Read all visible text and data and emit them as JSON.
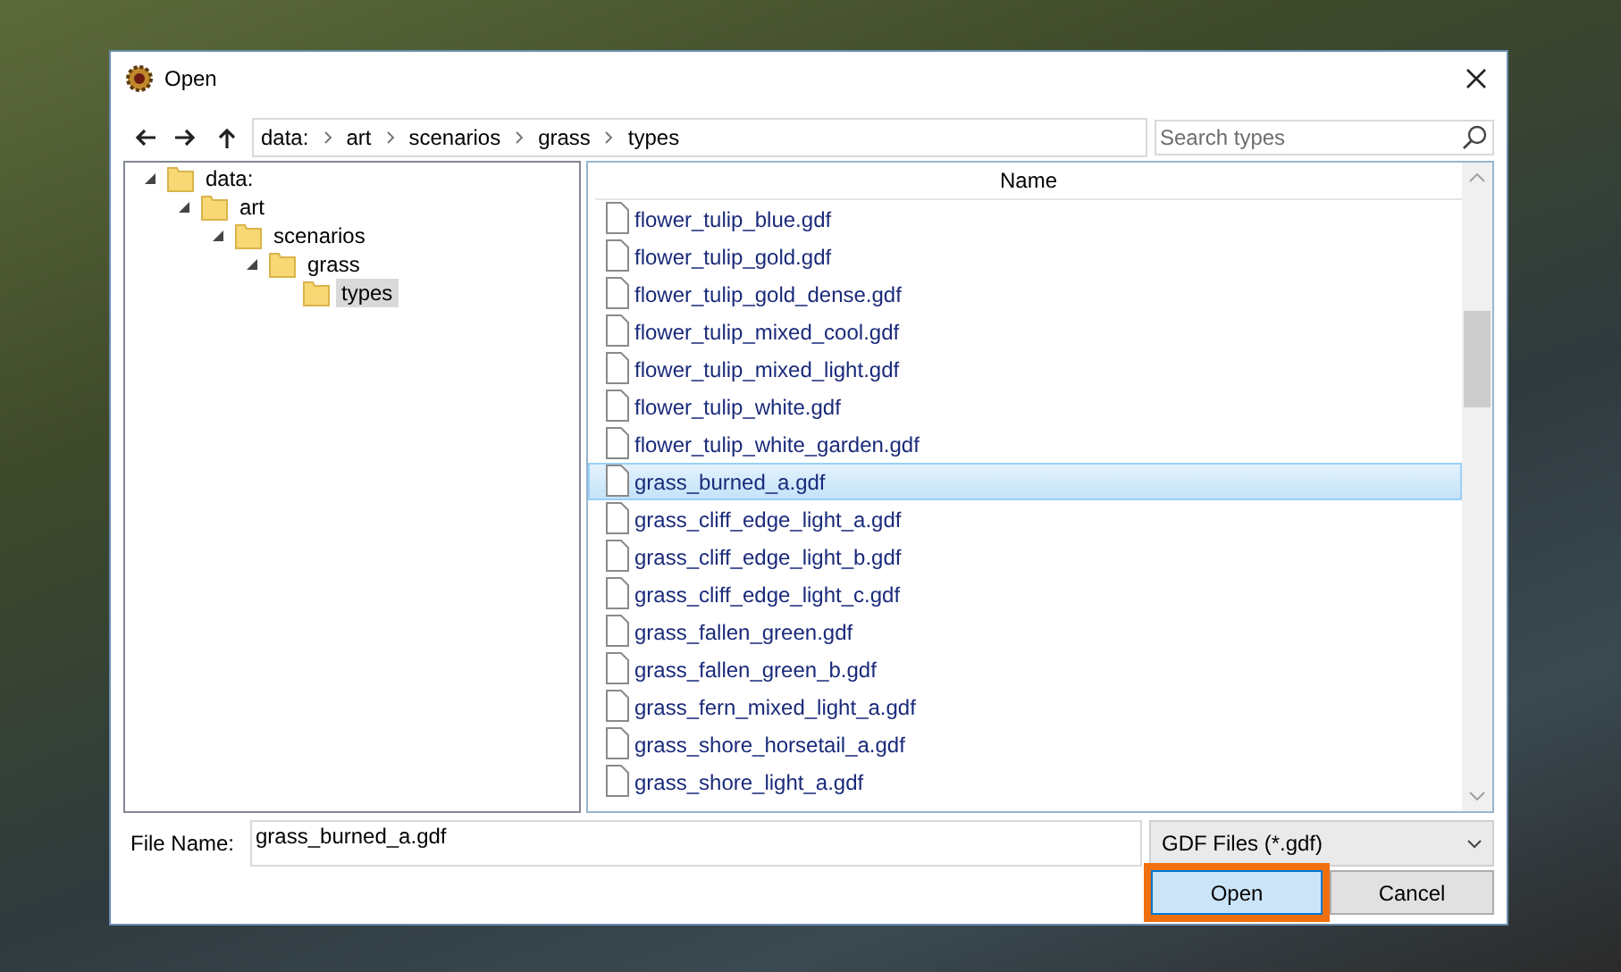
{
  "window": {
    "title": "Open"
  },
  "navigation": {
    "path": [
      "data:",
      "art",
      "scenarios",
      "grass",
      "types"
    ],
    "search": {
      "placeholder": "Search types"
    }
  },
  "folder_tree": [
    {
      "label": "data:",
      "expanded": true,
      "selected": false,
      "children": [
        {
          "label": "art",
          "expanded": true,
          "selected": false,
          "children": [
            {
              "label": "scenarios",
              "expanded": true,
              "selected": false,
              "children": [
                {
                  "label": "grass",
                  "expanded": true,
                  "selected": false,
                  "children": [
                    {
                      "label": "types",
                      "selected": true
                    }
                  ]
                }
              ]
            }
          ]
        }
      ]
    }
  ],
  "file_list": {
    "columns": [
      "Name"
    ],
    "rows": [
      {
        "name": "flower_tulip_blue.gdf",
        "selected": false
      },
      {
        "name": "flower_tulip_gold.gdf",
        "selected": false
      },
      {
        "name": "flower_tulip_gold_dense.gdf",
        "selected": false
      },
      {
        "name": "flower_tulip_mixed_cool.gdf",
        "selected": false
      },
      {
        "name": "flower_tulip_mixed_light.gdf",
        "selected": false
      },
      {
        "name": "flower_tulip_white.gdf",
        "selected": false
      },
      {
        "name": "flower_tulip_white_garden.gdf",
        "selected": false
      },
      {
        "name": "grass_burned_a.gdf",
        "selected": true
      },
      {
        "name": "grass_cliff_edge_light_a.gdf",
        "selected": false
      },
      {
        "name": "grass_cliff_edge_light_b.gdf",
        "selected": false
      },
      {
        "name": "grass_cliff_edge_light_c.gdf",
        "selected": false
      },
      {
        "name": "grass_fallen_green.gdf",
        "selected": false
      },
      {
        "name": "grass_fallen_green_b.gdf",
        "selected": false
      },
      {
        "name": "grass_fern_mixed_light_a.gdf",
        "selected": false
      },
      {
        "name": "grass_shore_horsetail_a.gdf",
        "selected": false
      },
      {
        "name": "grass_shore_light_a.gdf",
        "selected": false
      }
    ]
  },
  "file_name": {
    "label": "File Name:",
    "value": "grass_burned_a.gdf"
  },
  "file_type": {
    "value": "GDF Files (*.gdf)"
  },
  "buttons": [
    {
      "label": "Open",
      "default": true,
      "highlighted": true
    },
    {
      "label": "Cancel",
      "default": false,
      "highlighted": false
    }
  ]
}
